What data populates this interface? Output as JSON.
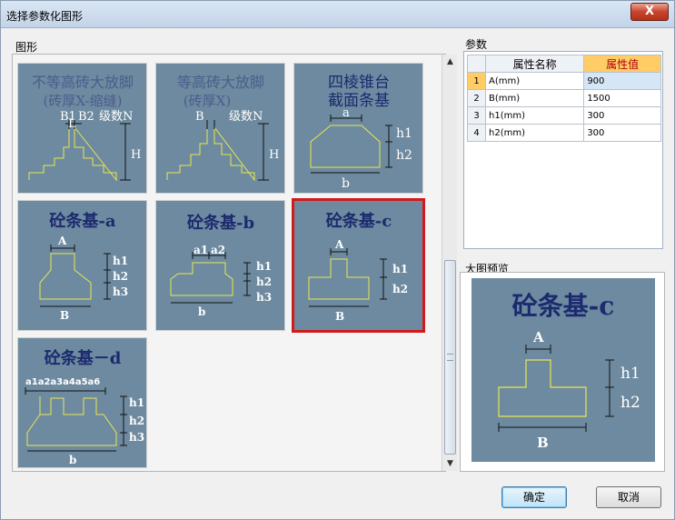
{
  "window": {
    "title": "选择参数化图形",
    "close_label": "X"
  },
  "shapes_group": {
    "label": "图形",
    "tiles": [
      {
        "line1": "不等高砖大放脚",
        "line2": "(砖厚X-缩缝)",
        "marks": {
          "b1": "B1",
          "l": "L",
          "b2": "B2",
          "n": "级数N",
          "h": "H"
        }
      },
      {
        "line1": "等高砖大放脚",
        "line2": "(砖厚X)",
        "marks": {
          "b": "B",
          "n": "级数N",
          "h": "H"
        }
      },
      {
        "line1": "四棱锥台",
        "line2": "截面条基",
        "marks": {
          "a": "a",
          "h1": "h1",
          "h2": "h2",
          "b": "b"
        }
      },
      {
        "line1": "砼条基-a",
        "marks": {
          "a": "A",
          "h1": "h1",
          "h2": "h2",
          "h3": "h3",
          "b": "B"
        }
      },
      {
        "line1": "砼条基-b",
        "marks": {
          "a1": "a1",
          "a2": "a2",
          "h1": "h1",
          "h2": "h2",
          "h3": "h3",
          "b": "b"
        }
      },
      {
        "line1": "砼条基-c",
        "marks": {
          "a": "A",
          "h1": "h1",
          "h2": "h2",
          "b": "B"
        }
      },
      {
        "line1": "砼条基－d",
        "marks": {
          "a": "a1a2a3a4a5a6",
          "h1": "h1",
          "h2": "h2",
          "h3": "h3",
          "b": "b"
        }
      }
    ],
    "selected_index": 5
  },
  "params_group": {
    "label": "参数",
    "columns": [
      "属性名称",
      "属性值"
    ],
    "rows": [
      {
        "idx": "1",
        "name": "A(mm)",
        "value": "900"
      },
      {
        "idx": "2",
        "name": "B(mm)",
        "value": "1500"
      },
      {
        "idx": "3",
        "name": "h1(mm)",
        "value": "300"
      },
      {
        "idx": "4",
        "name": "h2(mm)",
        "value": "300"
      }
    ]
  },
  "preview_group": {
    "label": "大图预览",
    "title": "砼条基-c",
    "marks": {
      "a": "A",
      "h1": "h1",
      "h2": "h2",
      "b": "B"
    }
  },
  "buttons": {
    "ok": "确定",
    "cancel": "取消"
  },
  "colors": {
    "tile_bg": "#6d8aa0",
    "title_text": "#1c2a6e",
    "outline": "#e8e850",
    "selected_border": "#d21a1a"
  }
}
